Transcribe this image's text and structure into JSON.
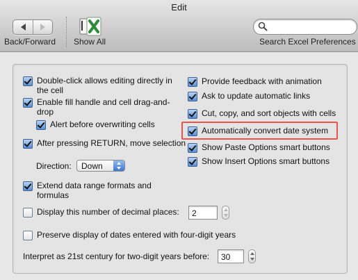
{
  "window": {
    "title": "Edit"
  },
  "toolbar": {
    "back_forward_label": "Back/Forward",
    "show_all_label": "Show All",
    "search_placeholder": "",
    "search_label": "Search Excel Preferences"
  },
  "options_left": {
    "double_click": {
      "label_line1": "Double-click allows editing directly in",
      "label_line2": "the cell",
      "checked": true
    },
    "fill_handle": {
      "label_line1": "Enable fill handle and cell drag-and-",
      "label_line2": "drop",
      "checked": true
    },
    "alert_overwrite": {
      "label": "Alert before overwriting cells",
      "checked": true
    },
    "after_return": {
      "label": "After pressing RETURN, move selection",
      "checked": true
    },
    "direction": {
      "label": "Direction:",
      "value": "Down"
    },
    "extend_range": {
      "label_line1": "Extend data range formats and",
      "label_line2": "formulas",
      "checked": true
    },
    "decimal_places": {
      "label": "Display this number of decimal places:",
      "value": "2",
      "checked": false
    },
    "four_digit_years": {
      "label": "Preserve display of dates entered with four-digit years",
      "checked": false
    },
    "century": {
      "label": "Interpret as 21st century for two-digit years before:",
      "value": "30"
    }
  },
  "options_right": {
    "feedback_animation": {
      "label": "Provide feedback with animation",
      "checked": true
    },
    "update_links": {
      "label": "Ask to update automatic links",
      "checked": true
    },
    "cut_copy_sort": {
      "label": "Cut, copy, and sort objects with cells",
      "checked": true
    },
    "auto_date_system": {
      "label": "Automatically convert date system",
      "checked": true
    },
    "paste_options": {
      "label": "Show Paste Options smart buttons",
      "checked": true
    },
    "insert_options": {
      "label": "Show Insert Options smart buttons",
      "checked": true
    }
  },
  "colors": {
    "highlight_border": "#e8554e",
    "checkbox_blue": "#5a8fd6",
    "excel_green": "#2e8b3a"
  }
}
